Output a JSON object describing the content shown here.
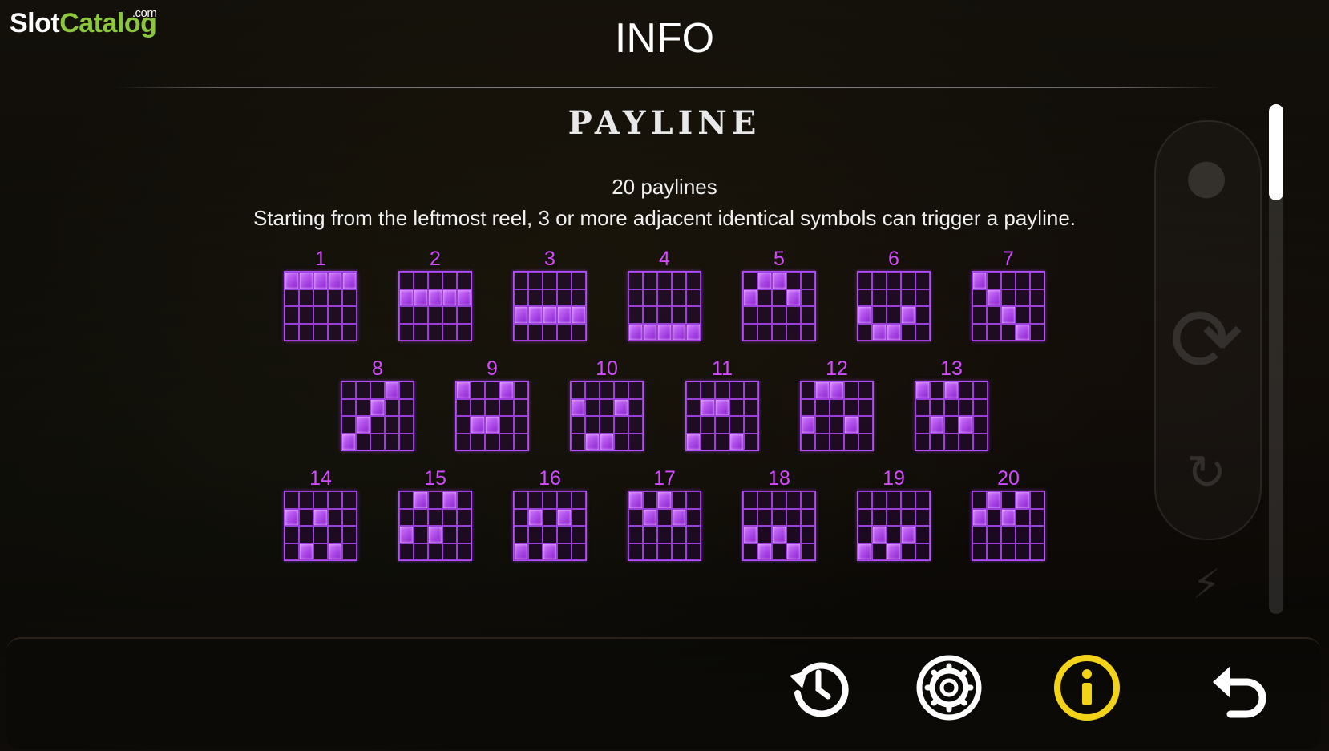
{
  "logo": {
    "slot": "Slot",
    "catalog": "Catalog",
    "dotcom": ".com"
  },
  "header": {
    "title": "INFO"
  },
  "section": {
    "title": "PAYLINE",
    "count_text": "20 paylines",
    "description": "Starting from the leftmost reel, 3 or more adjacent identical symbols can trigger a payline."
  },
  "paylines": [
    {
      "label": "1",
      "rows": [
        0,
        0,
        0,
        0,
        0
      ]
    },
    {
      "label": "2",
      "rows": [
        1,
        1,
        1,
        1,
        1
      ]
    },
    {
      "label": "3",
      "rows": [
        2,
        2,
        2,
        2,
        2
      ]
    },
    {
      "label": "4",
      "rows": [
        3,
        3,
        3,
        3,
        3
      ]
    },
    {
      "label": "5",
      "rows": [
        1,
        0,
        0,
        1,
        null
      ]
    },
    {
      "label": "6",
      "rows": [
        2,
        3,
        3,
        2,
        null
      ]
    },
    {
      "label": "7",
      "rows": [
        0,
        1,
        2,
        3,
        null
      ]
    },
    {
      "label": "8",
      "rows": [
        3,
        2,
        1,
        0,
        null
      ]
    },
    {
      "label": "9",
      "rows": [
        0,
        2,
        2,
        0,
        null
      ]
    },
    {
      "label": "10",
      "rows": [
        1,
        3,
        3,
        1,
        null
      ]
    },
    {
      "label": "11",
      "rows": [
        3,
        1,
        1,
        3,
        null
      ]
    },
    {
      "label": "12",
      "rows": [
        2,
        0,
        0,
        2,
        null
      ]
    },
    {
      "label": "13",
      "rows": [
        0,
        2,
        0,
        2,
        null
      ]
    },
    {
      "label": "14",
      "rows": [
        1,
        3,
        1,
        3,
        null
      ]
    },
    {
      "label": "15",
      "rows": [
        2,
        0,
        2,
        0,
        null
      ]
    },
    {
      "label": "16",
      "rows": [
        3,
        1,
        3,
        1,
        null
      ]
    },
    {
      "label": "17",
      "rows": [
        0,
        1,
        0,
        1,
        null
      ]
    },
    {
      "label": "18",
      "rows": [
        2,
        3,
        2,
        3,
        null
      ]
    },
    {
      "label": "19",
      "rows": [
        3,
        2,
        3,
        2,
        null
      ]
    },
    {
      "label": "20",
      "rows": [
        1,
        0,
        1,
        0,
        null
      ]
    }
  ],
  "bottom_buttons": [
    {
      "name": "history-button",
      "icon": "history-icon"
    },
    {
      "name": "settings-button",
      "icon": "gear-icon"
    },
    {
      "name": "info-button",
      "icon": "info-icon",
      "active_color": "#f3d21a"
    },
    {
      "name": "back-button",
      "icon": "return-arrow-icon"
    }
  ],
  "colors": {
    "payline_accent": "#d44aff",
    "cell_on": "#b24cf0",
    "info_active": "#f3d21a"
  }
}
